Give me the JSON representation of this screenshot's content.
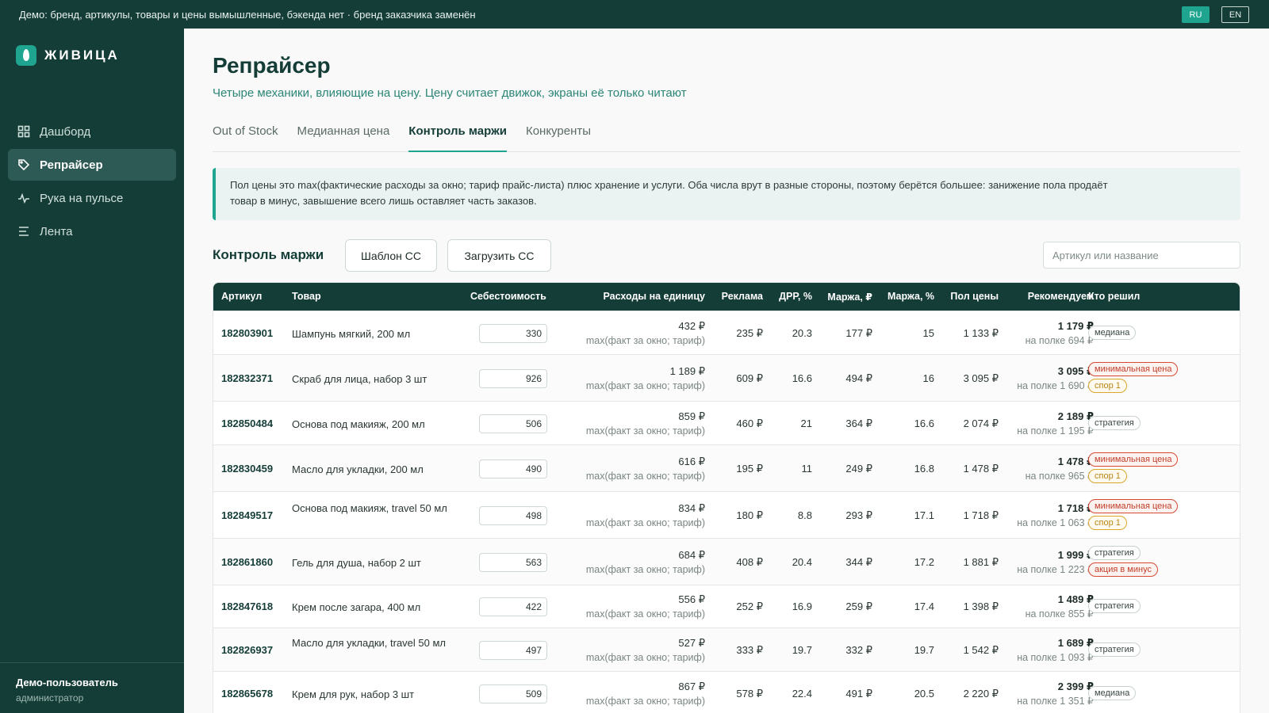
{
  "banner": {
    "text": "Демо: бренд, артикулы, товары и цены вымышленные, бэкенда нет · бренд заказчика заменён",
    "lang_ru": "RU",
    "lang_en": "EN"
  },
  "sidebar": {
    "logo": "ЖИВИЦА",
    "items": [
      {
        "label": "Дашборд",
        "icon": "grid-icon"
      },
      {
        "label": "Репрайсер",
        "icon": "tag-icon",
        "active": true
      },
      {
        "label": "Рука на пульсе",
        "icon": "pulse-icon"
      },
      {
        "label": "Лента",
        "icon": "list-icon"
      }
    ],
    "user_name": "Демо-пользователь",
    "user_role": "администратор"
  },
  "page": {
    "title": "Репрайсер",
    "subtitle": "Четыре механики, влияющие на цену. Цену считает движок, экраны её только читают",
    "tabs": [
      "Out of Stock",
      "Медианная цена",
      "Контроль маржи",
      "Конкуренты"
    ],
    "active_tab": 2,
    "note_line1": "Пол цены это max(фактические расходы за окно; тариф прайс-листа) плюс хранение и услуги. Оба числа врут в разные стороны, поэтому берётся большее: занижение пола продаёт",
    "note_line2": "товар в минус, завышение всего лишь оставляет часть заказов."
  },
  "section": {
    "title": "Контроль маржи",
    "btn_template": "Шаблон СС",
    "btn_upload": "Загрузить СС",
    "search_placeholder": "Артикул или название"
  },
  "table": {
    "headers": [
      "Артикул",
      "Товар",
      "Себестоимость",
      "Расходы на единицу",
      "Реклама",
      "ДРР, %",
      "Маржа, ₽",
      "Маржа, %",
      "Пол цены",
      "Рекомендуем",
      "Кто решил"
    ],
    "expense_note": "max(факт за окно; тариф)",
    "rows": [
      {
        "sku": "182803901",
        "name": "Шампунь мягкий, 200 мл",
        "cost": "330",
        "expense": "432 ₽",
        "ads": "235 ₽",
        "drr": "20.3",
        "margin_rub": "177 ₽",
        "margin_pct": "15",
        "floor": "1 133 ₽",
        "rec": "1 179 ₽",
        "shelf": "на полке 694 ₽",
        "tags": [
          {
            "text": "медиана",
            "style": "gray"
          }
        ]
      },
      {
        "sku": "182832371",
        "name": "Скраб для лица, набор 3 шт",
        "cost": "926",
        "expense": "1 189 ₽",
        "ads": "609 ₽",
        "drr": "16.6",
        "margin_rub": "494 ₽",
        "margin_pct": "16",
        "floor": "3 095 ₽",
        "rec": "3 095 ₽",
        "shelf": "на полке 1 690 ₽",
        "tags": [
          {
            "text": "минимальная цена",
            "style": "red"
          },
          {
            "text": "спор 1",
            "style": "yellow"
          }
        ]
      },
      {
        "sku": "182850484",
        "name": "Основа под макияж, 200 мл",
        "cost": "506",
        "expense": "859 ₽",
        "ads": "460 ₽",
        "drr": "21",
        "margin_rub": "364 ₽",
        "margin_pct": "16.6",
        "floor": "2 074 ₽",
        "rec": "2 189 ₽",
        "shelf": "на полке 1 195 ₽",
        "tags": [
          {
            "text": "стратегия",
            "style": "gray"
          }
        ]
      },
      {
        "sku": "182830459",
        "name": "Масло для укладки, 200 мл",
        "cost": "490",
        "expense": "616 ₽",
        "ads": "195 ₽",
        "drr": "11",
        "margin_rub": "249 ₽",
        "margin_pct": "16.8",
        "floor": "1 478 ₽",
        "rec": "1 478 ₽",
        "shelf": "на полке 965 ₽",
        "tags": [
          {
            "text": "минимальная цена",
            "style": "red"
          },
          {
            "text": "спор 1",
            "style": "yellow"
          }
        ]
      },
      {
        "sku": "182849517",
        "name": "Основа под макияж, travel 50 мл",
        "cost": "498",
        "expense": "834 ₽",
        "ads": "180 ₽",
        "drr": "8.8",
        "margin_rub": "293 ₽",
        "margin_pct": "17.1",
        "floor": "1 718 ₽",
        "rec": "1 718 ₽",
        "shelf": "на полке 1 063 ₽",
        "tags": [
          {
            "text": "минимальная цена",
            "style": "red"
          },
          {
            "text": "спор 1",
            "style": "yellow"
          }
        ]
      },
      {
        "sku": "182861860",
        "name": "Гель для душа, набор 2 шт",
        "cost": "563",
        "expense": "684 ₽",
        "ads": "408 ₽",
        "drr": "20.4",
        "margin_rub": "344 ₽",
        "margin_pct": "17.2",
        "floor": "1 881 ₽",
        "rec": "1 999 ₽",
        "shelf": "на полке 1 223 ₽",
        "tags": [
          {
            "text": "стратегия",
            "style": "gray"
          },
          {
            "text": "акция в минус",
            "style": "red"
          }
        ]
      },
      {
        "sku": "182847618",
        "name": "Крем после загара, 400 мл",
        "cost": "422",
        "expense": "556 ₽",
        "ads": "252 ₽",
        "drr": "16.9",
        "margin_rub": "259 ₽",
        "margin_pct": "17.4",
        "floor": "1 398 ₽",
        "rec": "1 489 ₽",
        "shelf": "на полке 855 ₽",
        "tags": [
          {
            "text": "стратегия",
            "style": "gray"
          }
        ]
      },
      {
        "sku": "182826937",
        "name": "Масло для укладки, travel 50 мл",
        "cost": "497",
        "expense": "527 ₽",
        "ads": "333 ₽",
        "drr": "19.7",
        "margin_rub": "332 ₽",
        "margin_pct": "19.7",
        "floor": "1 542 ₽",
        "rec": "1 689 ₽",
        "shelf": "на полке 1 093 ₽",
        "tags": [
          {
            "text": "стратегия",
            "style": "gray"
          }
        ]
      },
      {
        "sku": "182865678",
        "name": "Крем для рук, набор 3 шт",
        "cost": "509",
        "expense": "867 ₽",
        "ads": "578 ₽",
        "drr": "22.4",
        "margin_rub": "491 ₽",
        "margin_pct": "20.5",
        "floor": "2 220 ₽",
        "rec": "2 399 ₽",
        "shelf": "на полке 1 351 ₽",
        "tags": [
          {
            "text": "медиана",
            "style": "gray"
          }
        ]
      }
    ]
  }
}
